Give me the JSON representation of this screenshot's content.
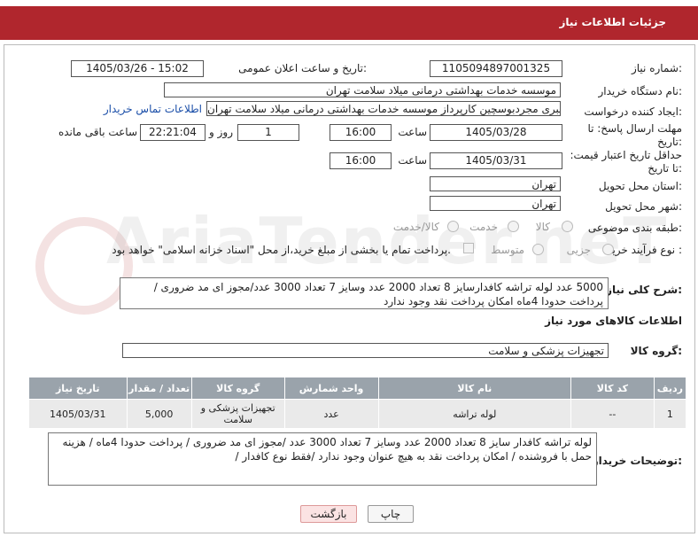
{
  "header": {
    "title": "جزئیات اطلاعات نیاز"
  },
  "need_number": {
    "label": "شماره نیاز:",
    "value": "1105094897001325"
  },
  "announce": {
    "label": "تاریخ و ساعت اعلان عمومی:",
    "value": "1405/03/26 - 15:02"
  },
  "buyer_org": {
    "label": "نام دستگاه خریدار:",
    "value": "موسسه خدمات بهداشتی درمانی میلاد سلامت تهران"
  },
  "requester": {
    "label": "ایجاد کننده درخواست:",
    "value": "بهنام قنبری مجردبوسچین کارپرداز موسسه خدمات بهداشتی درمانی میلاد سلامت تهران",
    "contact_link": "اطلاعات تماس خریدار"
  },
  "deadline": {
    "label": "مهلت ارسال پاسخ: تا تاریخ:",
    "date": "1405/03/28",
    "time_label": "ساعت",
    "time": "16:00",
    "days": "1",
    "days_label": "روز و",
    "remaining": "22:21:04",
    "remaining_label": "ساعت باقی مانده"
  },
  "validity": {
    "label": "حداقل تاریخ اعتبار قیمت: تا تاریخ:",
    "date": "1405/03/31",
    "time_label": "ساعت",
    "time": "16:00"
  },
  "province": {
    "label": "استان محل تحویل:",
    "value": "تهران"
  },
  "city": {
    "label": "شهر محل تحویل:",
    "value": "تهران"
  },
  "category": {
    "label": "طبقه بندی موضوعی:",
    "options": [
      "کالا",
      "خدمت",
      "کالا/خدمت"
    ]
  },
  "process": {
    "label": "نوع فرآیند خرید :",
    "options": [
      "جزیی",
      "متوسط"
    ],
    "payment_note": "پرداخت تمام یا بخشی از مبلغ خرید،از محل \"اسناد خزانه اسلامی\" خواهد بود."
  },
  "description": {
    "label": "شرح کلی نیاز:",
    "value": "5000 عدد لوله تراشه کافدارسایز 8 تعداد 2000 عدد وسایز 7 تعداد 3000 عدد/مجوز ای مد ضروری / پرداخت حدودا 4ماه  امکان پرداخت نقد  وجود ندارد"
  },
  "goods_info": {
    "title": "اطلاعات کالاهای مورد نیاز"
  },
  "goods_group": {
    "label": "گروه کالا:",
    "value": "تجهیزات پزشکی و سلامت"
  },
  "table": {
    "headers": [
      "ردیف",
      "کد کالا",
      "نام کالا",
      "واحد شمارش",
      "گروه کالا",
      "تعداد / مقدار",
      "تاریخ نیاز"
    ],
    "rows": [
      [
        "1",
        "--",
        "لوله تراشه",
        "عدد",
        "تجهیزات پزشکی و سلامت",
        "5,000",
        "1405/03/31"
      ]
    ]
  },
  "buyer_notes": {
    "label": "توضیحات خریدار:",
    "value": "لوله تراشه کافدار   سایز 8 تعداد 2000  عدد وسایز 7 تعداد 3000 عدد   /مجوز ای مد ضروری / پرداخت حدودا 4ماه / هزینه حمل با فروشنده / امکان پرداخت نقد به هیچ عنوان وجود ندارد /فقط نوع کافدار  /"
  },
  "buttons": {
    "print": "چاپ",
    "back": "بازگشت"
  },
  "watermark": "AriaTender.neT",
  "colors": {
    "header": "#b0262d",
    "table_header": "#9aa3ab",
    "link": "#1a4ea8"
  }
}
